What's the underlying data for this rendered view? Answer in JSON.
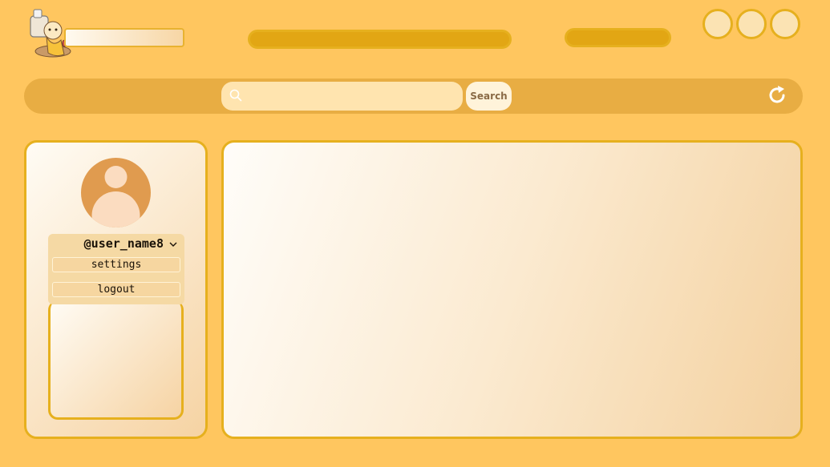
{
  "header": {
    "logo_icon": "chef-mascot-logo",
    "circle_buttons": [
      "circle-button-1",
      "circle-button-2",
      "circle-button-3"
    ]
  },
  "toolbar": {
    "search_placeholder": "",
    "search_value": "",
    "search_label": "Search",
    "refresh_icon": "refresh-icon"
  },
  "profile": {
    "username": "@user_name8",
    "avatar_icon": "user-avatar-icon",
    "menu": {
      "settings_label": "settings",
      "logout_label": "logout"
    }
  },
  "colors": {
    "background": "#ffc65f",
    "accent": "#e6b01e",
    "bar": "#e2a614",
    "toolbar": "#e8ad43",
    "avatar": "#e09b4f",
    "avatar_figure": "#fbdcc0"
  }
}
